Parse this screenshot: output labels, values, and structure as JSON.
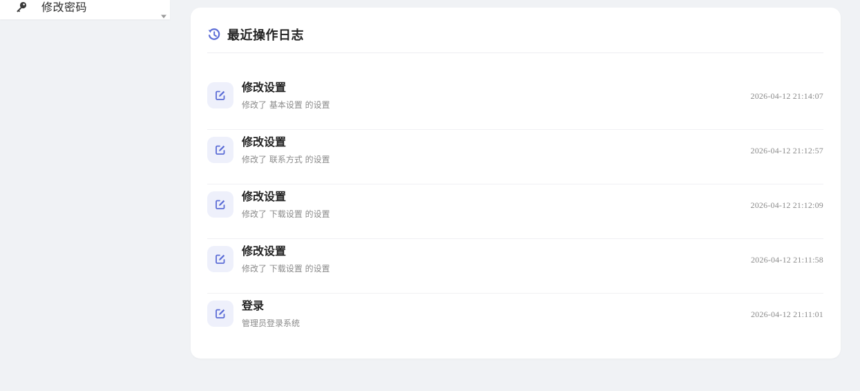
{
  "menu": {
    "items": [
      {
        "label": "修改密码",
        "icon": "key-icon"
      }
    ],
    "caret_icon": "caret-down-icon"
  },
  "card": {
    "icon": "history-icon",
    "title": "最近操作日志",
    "accent_color": "#5b6cd6",
    "logs": [
      {
        "title": "修改设置",
        "description": "修改了 基本设置 的设置",
        "time": "2026-04-12 21:14:07",
        "icon": "edit-icon"
      },
      {
        "title": "修改设置",
        "description": "修改了 联系方式 的设置",
        "time": "2026-04-12 21:12:57",
        "icon": "edit-icon"
      },
      {
        "title": "修改设置",
        "description": "修改了 下载设置 的设置",
        "time": "2026-04-12 21:12:09",
        "icon": "edit-icon"
      },
      {
        "title": "修改设置",
        "description": "修改了 下载设置 的设置",
        "time": "2026-04-12 21:11:58",
        "icon": "edit-icon"
      },
      {
        "title": "登录",
        "description": "管理员登录系统",
        "time": "2026-04-12 21:11:01",
        "icon": "edit-icon"
      }
    ]
  }
}
